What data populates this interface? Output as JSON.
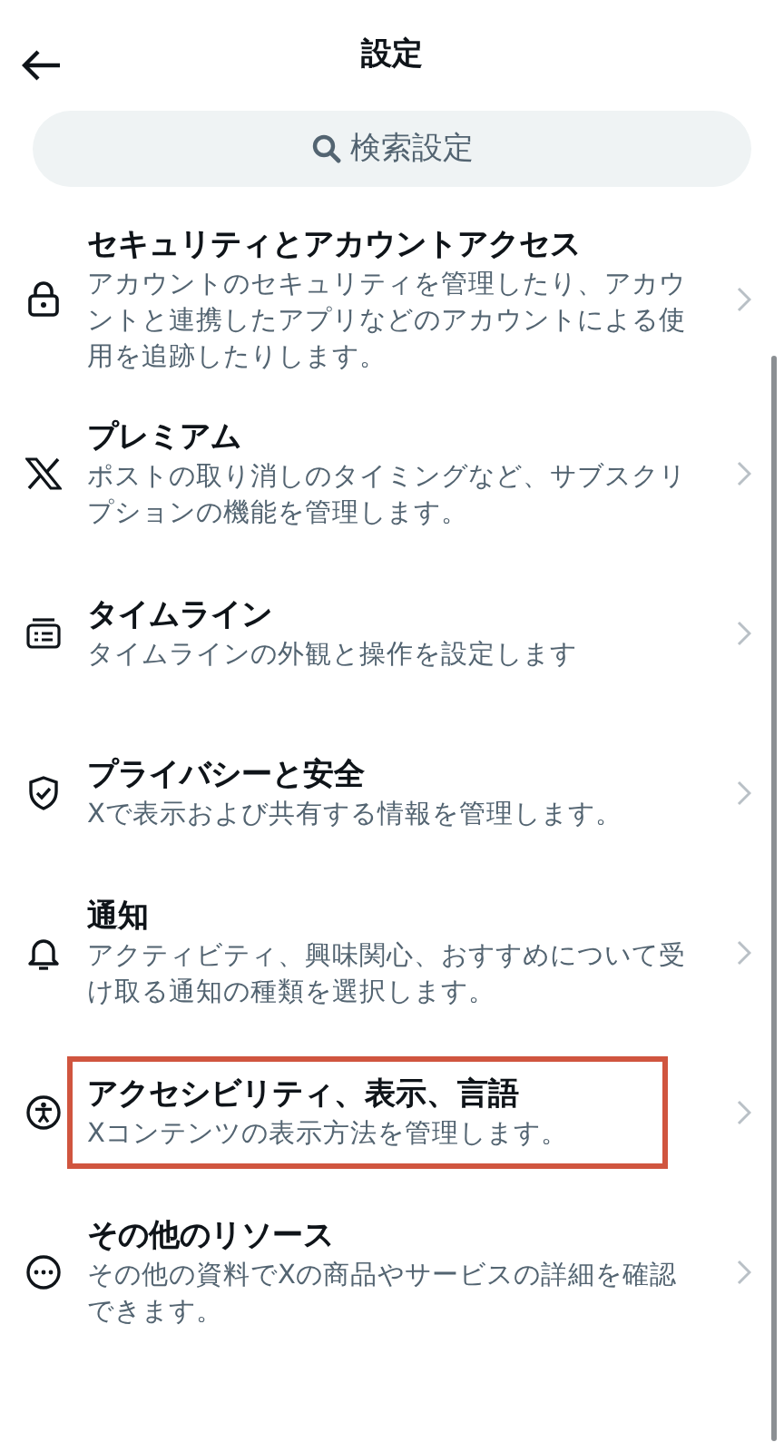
{
  "header": {
    "title": "設定"
  },
  "search": {
    "placeholder": "検索設定"
  },
  "items": [
    {
      "kind": "lock",
      "title": "セキュリティとアカウントアクセス",
      "description": "アカウントのセキュリティを管理したり、アカウントと連携したアプリなどのアカウントによる使用を追跡したりします。",
      "highlighted": false
    },
    {
      "kind": "x",
      "title": "プレミアム",
      "description": "ポストの取り消しのタイミングなど、サブスクリプションの機能を管理します。",
      "highlighted": false
    },
    {
      "kind": "timeline",
      "title": "タイムライン",
      "description": "タイムラインの外観と操作を設定します",
      "highlighted": false
    },
    {
      "kind": "shield",
      "title": "プライバシーと安全",
      "description": "Xで表示および共有する情報を管理します。",
      "highlighted": false
    },
    {
      "kind": "bell",
      "title": "通知",
      "description": "アクティビティ、興味関心、おすすめについて受け取る通知の種類を選択します。",
      "highlighted": false
    },
    {
      "kind": "accessibility",
      "title": "アクセシビリティ、表示、言語",
      "description": "Xコンテンツの表示方法を管理します。",
      "highlighted": true
    },
    {
      "kind": "more",
      "title": "その他のリソース",
      "description": "その他の資料でXの商品やサービスの詳細を確認できます。",
      "highlighted": false
    }
  ]
}
